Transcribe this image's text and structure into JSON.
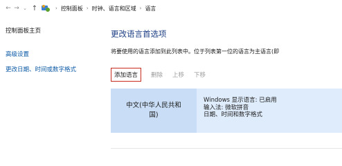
{
  "breadcrumb": {
    "items": [
      "控制面板",
      "时钟、语言和区域",
      "语言"
    ]
  },
  "sidebar": {
    "home": "控制面板主页",
    "links": [
      "高级设置",
      "更改日期、时间或数字格式"
    ]
  },
  "main": {
    "title": "更改语言首选项",
    "description": "将要使用的语言添加到此列表中。位于列表第一位的语言为主语言(即",
    "toolbar": {
      "add": "添加语言",
      "remove": "删除",
      "move_up": "上移",
      "move_down": "下移"
    },
    "language": {
      "name": "中文(中华人民共和国)",
      "details": [
        "Windows 显示语言: 已启用",
        "输入法: 微软拼音",
        "日期、时间和数字格式"
      ]
    }
  },
  "colors": {
    "link": "#0a58a5",
    "title": "#1c3f84",
    "add_border": "#c72a1c",
    "row_bg": "#dfecfb",
    "name_bg": "#c9def6"
  },
  "icons": [
    "back-arrow-icon",
    "forward-arrow-icon",
    "chevron-down-icon",
    "up-arrow-icon",
    "control-panel-icon"
  ]
}
